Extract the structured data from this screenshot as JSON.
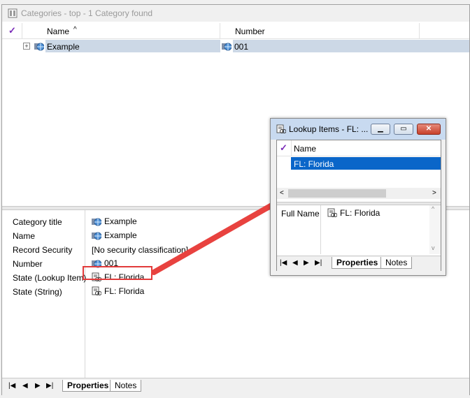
{
  "main_window": {
    "title": "Categories - top - 1 Category found",
    "columns": {
      "name": "Name",
      "number": "Number"
    },
    "sort_indicator": "^",
    "rows": [
      {
        "name": "Example",
        "number": "001"
      }
    ],
    "properties": [
      {
        "label": "Category title",
        "value": "Example",
        "icon": "category-globe-icon"
      },
      {
        "label": "Name",
        "value": "Example",
        "icon": "category-globe-icon"
      },
      {
        "label": "Record Security",
        "value": "[No security classification]",
        "icon": ""
      },
      {
        "label": "Number",
        "value": "001",
        "icon": "category-globe-icon"
      },
      {
        "label": "State (Lookup Item)",
        "value": "FL: Florida",
        "icon": "lookup-item-icon"
      },
      {
        "label": "State (String)",
        "value": "FL: Florida",
        "icon": "lookup-item-icon"
      }
    ],
    "tabs": {
      "properties": "Properties",
      "notes": "Notes"
    }
  },
  "lookup_window": {
    "title": "Lookup Items - FL: ...",
    "column_name": "Name",
    "rows": [
      {
        "name": "FL: Florida",
        "selected": true
      }
    ],
    "properties": [
      {
        "label": "Full Name",
        "value": "FL: Florida"
      }
    ],
    "tabs": {
      "properties": "Properties",
      "notes": "Notes"
    }
  },
  "colors": {
    "selection_blue": "#0a66c9",
    "row_selected": "#ccd8e6",
    "arrow_red": "#e8423f",
    "checkmark_purple": "#7a2bb8"
  }
}
